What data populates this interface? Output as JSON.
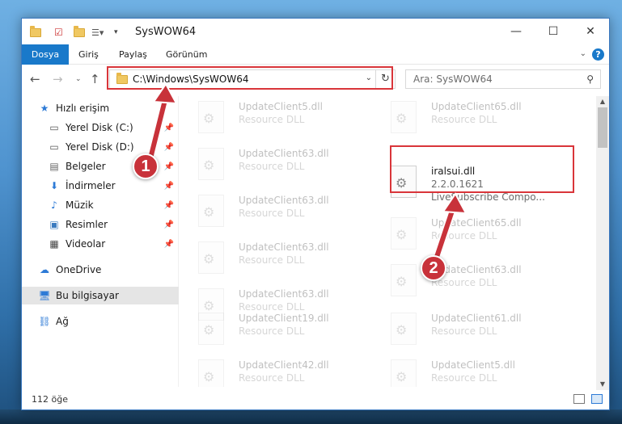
{
  "window": {
    "title": "SysWOW64"
  },
  "ribbon": {
    "tabs": [
      "Dosya",
      "Giriş",
      "Paylaş",
      "Görünüm"
    ]
  },
  "nav": {
    "address": "C:\\Windows\\SysWOW64",
    "search_placeholder": "Ara: SysWOW64"
  },
  "sidebar": {
    "items": [
      {
        "label": "Hızlı erişim",
        "icon": "star-icon",
        "pinned": false
      },
      {
        "label": "Yerel Disk (C:)",
        "icon": "drive-icon",
        "pinned": true
      },
      {
        "label": "Yerel Disk (D:)",
        "icon": "drive-icon",
        "pinned": true
      },
      {
        "label": "Belgeler",
        "icon": "documents-icon",
        "pinned": true
      },
      {
        "label": "İndirmeler",
        "icon": "download-icon",
        "pinned": true
      },
      {
        "label": "Müzik",
        "icon": "music-icon",
        "pinned": true
      },
      {
        "label": "Resimler",
        "icon": "pictures-icon",
        "pinned": true
      },
      {
        "label": "Videolar",
        "icon": "videos-icon",
        "pinned": true
      },
      {
        "label": "OneDrive",
        "icon": "cloud-icon",
        "pinned": false
      },
      {
        "label": "Bu bilgisayar",
        "icon": "computer-icon",
        "pinned": false,
        "selected": true
      },
      {
        "label": "Ağ",
        "icon": "network-icon",
        "pinned": false
      }
    ]
  },
  "files": {
    "left": [
      {
        "name": "UpdateClient5.dll",
        "desc": "Resource DLL"
      },
      {
        "name": "UpdateClient63.dll",
        "desc": "Resource DLL"
      },
      {
        "name": "UpdateClient63.dll",
        "desc": "Resource DLL"
      },
      {
        "name": "UpdateClient63.dll",
        "desc": "Resource DLL"
      },
      {
        "name": "UpdateClient63.dll",
        "desc": "Resource DLL"
      },
      {
        "name": "UpdateClient19.dll",
        "desc": "Resource DLL"
      },
      {
        "name": "UpdateClient42.dll",
        "desc": "Resource DLL"
      }
    ],
    "right": [
      {
        "name": "UpdateClient65.dll",
        "desc": "Resource DLL"
      },
      {
        "name": "UpdateClient65.dll",
        "desc": "Resource DLL"
      },
      {
        "name": "UpdateClient63.dll",
        "desc": "Resource DLL"
      },
      {
        "name": "UpdateClient61.dll",
        "desc": "Resource DLL"
      },
      {
        "name": "UpdateClient5.dll",
        "desc": "Resource DLL"
      }
    ],
    "highlighted": {
      "name": "iralsui.dll",
      "version": "2.2.0.1621",
      "desc": "LiveSubscribe Compo..."
    }
  },
  "status": {
    "count": "112 öğe"
  },
  "annotations": {
    "badge1": "1",
    "badge2": "2",
    "color": "#c8323a"
  }
}
